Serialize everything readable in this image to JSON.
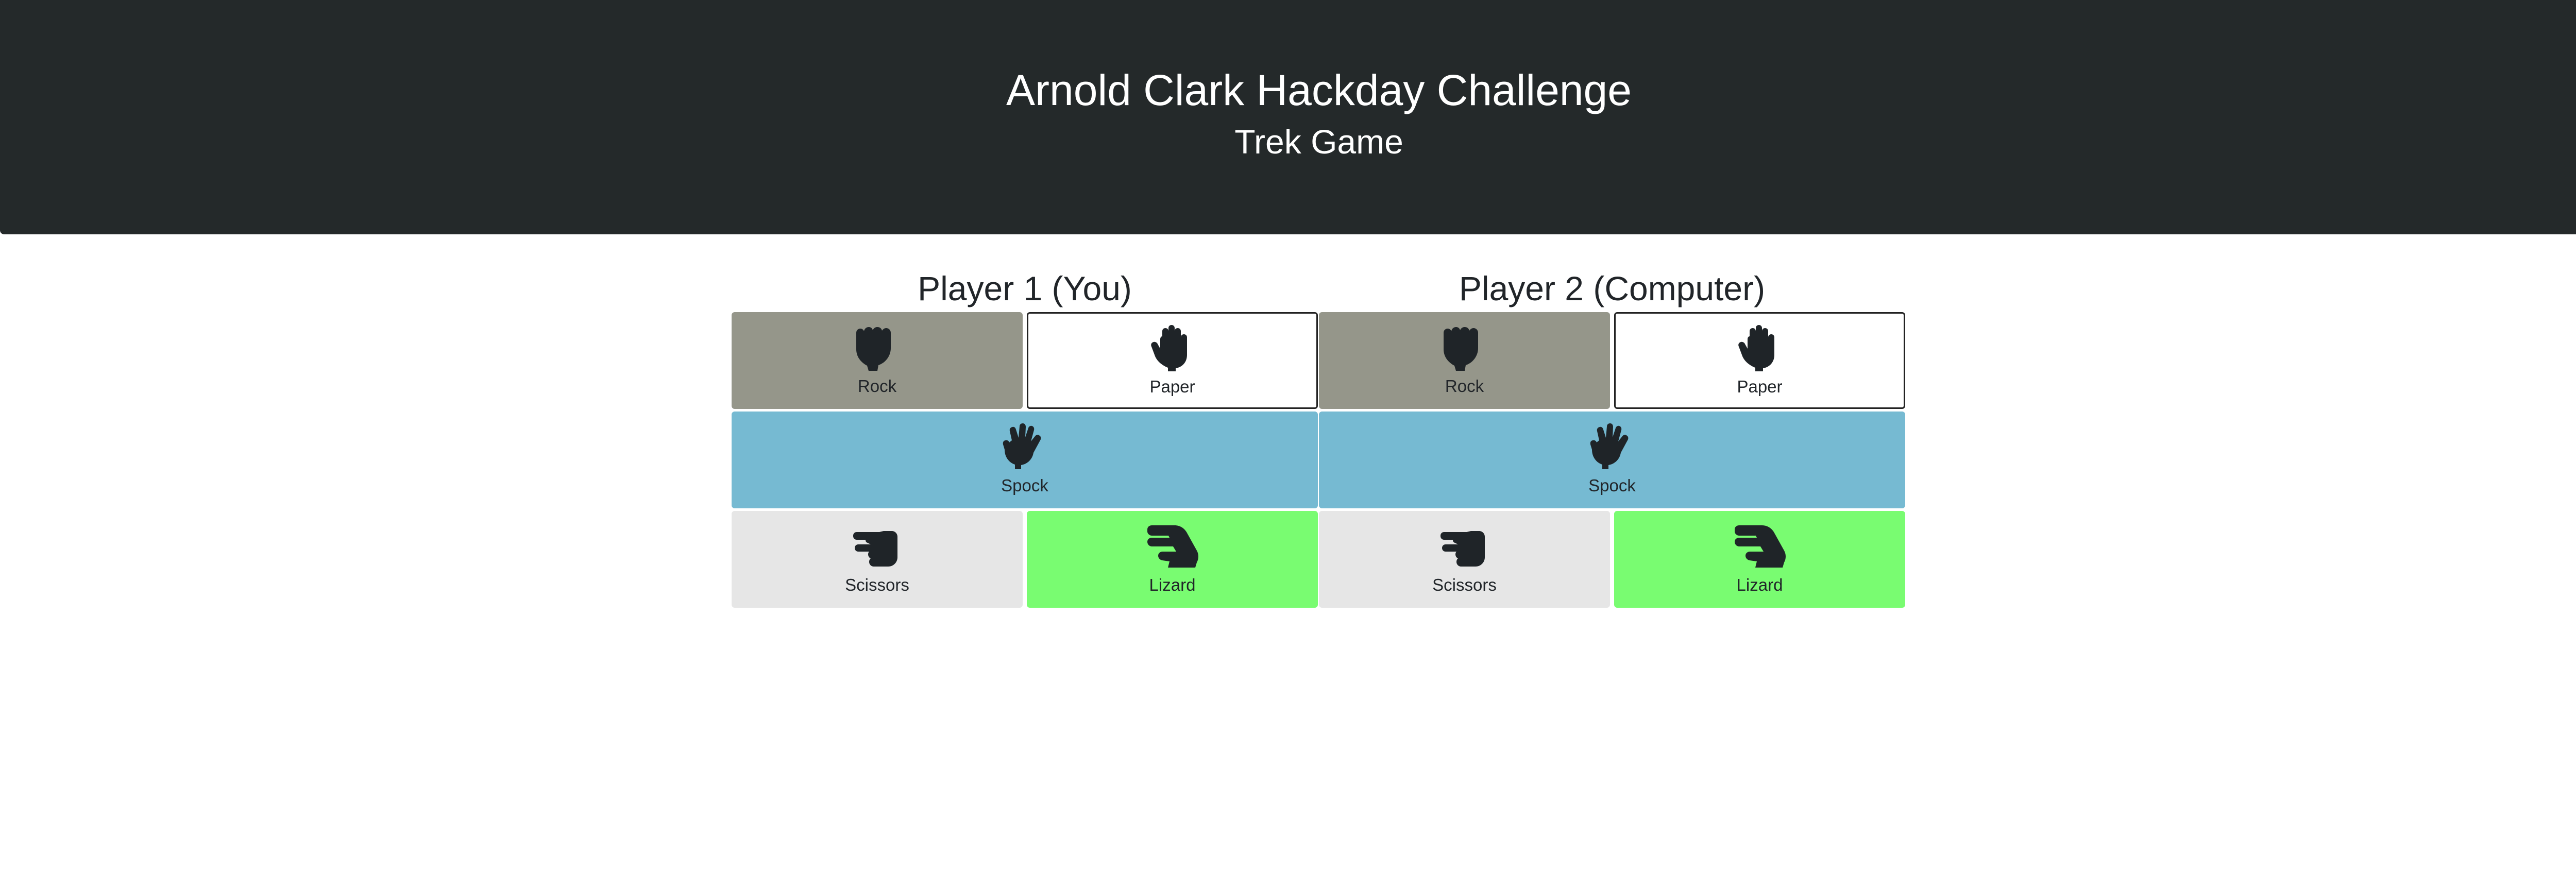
{
  "header": {
    "title": "Arnold Clark Hackday Challenge",
    "subtitle": "Trek Game"
  },
  "players": [
    {
      "title": "Player 1 (You)",
      "choices": {
        "rock": "Rock",
        "paper": "Paper",
        "spock": "Spock",
        "scissors": "Scissors",
        "lizard": "Lizard"
      }
    },
    {
      "title": "Player 2 (Computer)",
      "choices": {
        "rock": "Rock",
        "paper": "Paper",
        "spock": "Spock",
        "scissors": "Scissors",
        "lizard": "Lizard"
      }
    }
  ],
  "icons": {
    "rock": "fist-hand-icon",
    "paper": "open-hand-icon",
    "spock": "vulcan-salute-hand-icon",
    "scissors": "scissors-hand-icon",
    "lizard": "lizard-hand-icon"
  },
  "colors": {
    "header_bg": "#24292a",
    "rock": "#95968a",
    "paper": "#ffffff",
    "spock": "#76bad2",
    "scissors": "#e6e6e6",
    "lizard": "#79fc71",
    "icon": "#1f2428"
  }
}
